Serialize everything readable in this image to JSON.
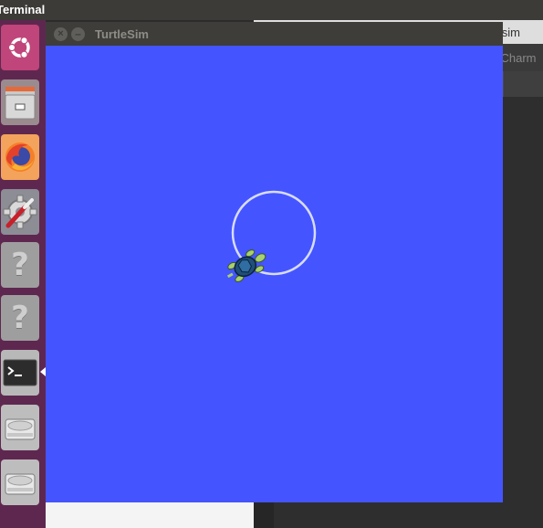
{
  "topbar": {
    "title": "Terminal"
  },
  "launcher": {
    "items": [
      {
        "name": "ubuntu-dash",
        "icon": "ubuntu-logo-icon"
      },
      {
        "name": "files",
        "icon": "file-cabinet-icon"
      },
      {
        "name": "firefox",
        "icon": "firefox-icon"
      },
      {
        "name": "system-settings",
        "icon": "settings-wrench-icon"
      },
      {
        "name": "unknown-app-1",
        "icon": "question-mark-icon",
        "glyph": "?"
      },
      {
        "name": "unknown-app-2",
        "icon": "question-mark-icon",
        "glyph": "?"
      },
      {
        "name": "terminal",
        "icon": "terminal-icon",
        "active": true
      },
      {
        "name": "drive-1",
        "icon": "hard-drive-icon"
      },
      {
        "name": "drive-2",
        "icon": "hard-drive-icon"
      }
    ]
  },
  "turtlesim": {
    "title": "TurtleSim",
    "background_color": "#4455ff",
    "path_color": "#d8dcff",
    "close_glyph": "×",
    "minimize_glyph": "–"
  },
  "background_app": {
    "tab_text": "tlesim",
    "toolbar_text": "yCharm"
  }
}
